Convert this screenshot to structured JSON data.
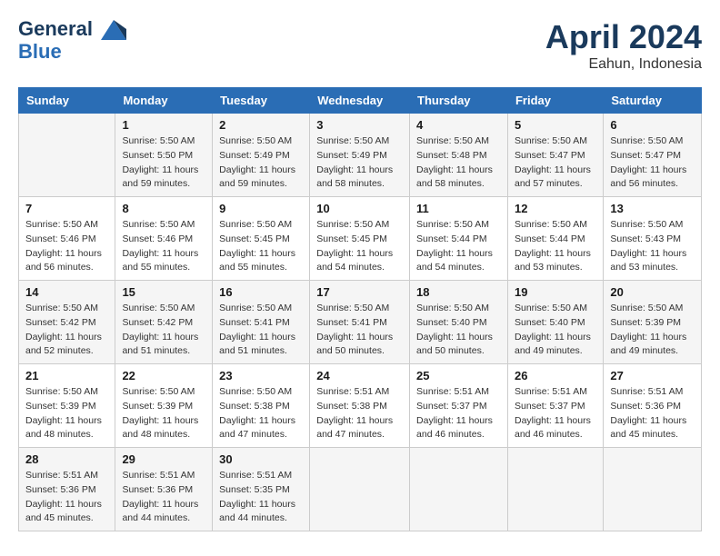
{
  "header": {
    "logo_line1": "General",
    "logo_line2": "Blue",
    "month_title": "April 2024",
    "location": "Eahun, Indonesia"
  },
  "days_of_week": [
    "Sunday",
    "Monday",
    "Tuesday",
    "Wednesday",
    "Thursday",
    "Friday",
    "Saturday"
  ],
  "weeks": [
    [
      {
        "day": "",
        "details": ""
      },
      {
        "day": "1",
        "details": "Sunrise: 5:50 AM\nSunset: 5:50 PM\nDaylight: 11 hours\nand 59 minutes."
      },
      {
        "day": "2",
        "details": "Sunrise: 5:50 AM\nSunset: 5:49 PM\nDaylight: 11 hours\nand 59 minutes."
      },
      {
        "day": "3",
        "details": "Sunrise: 5:50 AM\nSunset: 5:49 PM\nDaylight: 11 hours\nand 58 minutes."
      },
      {
        "day": "4",
        "details": "Sunrise: 5:50 AM\nSunset: 5:48 PM\nDaylight: 11 hours\nand 58 minutes."
      },
      {
        "day": "5",
        "details": "Sunrise: 5:50 AM\nSunset: 5:47 PM\nDaylight: 11 hours\nand 57 minutes."
      },
      {
        "day": "6",
        "details": "Sunrise: 5:50 AM\nSunset: 5:47 PM\nDaylight: 11 hours\nand 56 minutes."
      }
    ],
    [
      {
        "day": "7",
        "details": "Sunrise: 5:50 AM\nSunset: 5:46 PM\nDaylight: 11 hours\nand 56 minutes."
      },
      {
        "day": "8",
        "details": "Sunrise: 5:50 AM\nSunset: 5:46 PM\nDaylight: 11 hours\nand 55 minutes."
      },
      {
        "day": "9",
        "details": "Sunrise: 5:50 AM\nSunset: 5:45 PM\nDaylight: 11 hours\nand 55 minutes."
      },
      {
        "day": "10",
        "details": "Sunrise: 5:50 AM\nSunset: 5:45 PM\nDaylight: 11 hours\nand 54 minutes."
      },
      {
        "day": "11",
        "details": "Sunrise: 5:50 AM\nSunset: 5:44 PM\nDaylight: 11 hours\nand 54 minutes."
      },
      {
        "day": "12",
        "details": "Sunrise: 5:50 AM\nSunset: 5:44 PM\nDaylight: 11 hours\nand 53 minutes."
      },
      {
        "day": "13",
        "details": "Sunrise: 5:50 AM\nSunset: 5:43 PM\nDaylight: 11 hours\nand 53 minutes."
      }
    ],
    [
      {
        "day": "14",
        "details": "Sunrise: 5:50 AM\nSunset: 5:42 PM\nDaylight: 11 hours\nand 52 minutes."
      },
      {
        "day": "15",
        "details": "Sunrise: 5:50 AM\nSunset: 5:42 PM\nDaylight: 11 hours\nand 51 minutes."
      },
      {
        "day": "16",
        "details": "Sunrise: 5:50 AM\nSunset: 5:41 PM\nDaylight: 11 hours\nand 51 minutes."
      },
      {
        "day": "17",
        "details": "Sunrise: 5:50 AM\nSunset: 5:41 PM\nDaylight: 11 hours\nand 50 minutes."
      },
      {
        "day": "18",
        "details": "Sunrise: 5:50 AM\nSunset: 5:40 PM\nDaylight: 11 hours\nand 50 minutes."
      },
      {
        "day": "19",
        "details": "Sunrise: 5:50 AM\nSunset: 5:40 PM\nDaylight: 11 hours\nand 49 minutes."
      },
      {
        "day": "20",
        "details": "Sunrise: 5:50 AM\nSunset: 5:39 PM\nDaylight: 11 hours\nand 49 minutes."
      }
    ],
    [
      {
        "day": "21",
        "details": "Sunrise: 5:50 AM\nSunset: 5:39 PM\nDaylight: 11 hours\nand 48 minutes."
      },
      {
        "day": "22",
        "details": "Sunrise: 5:50 AM\nSunset: 5:39 PM\nDaylight: 11 hours\nand 48 minutes."
      },
      {
        "day": "23",
        "details": "Sunrise: 5:50 AM\nSunset: 5:38 PM\nDaylight: 11 hours\nand 47 minutes."
      },
      {
        "day": "24",
        "details": "Sunrise: 5:51 AM\nSunset: 5:38 PM\nDaylight: 11 hours\nand 47 minutes."
      },
      {
        "day": "25",
        "details": "Sunrise: 5:51 AM\nSunset: 5:37 PM\nDaylight: 11 hours\nand 46 minutes."
      },
      {
        "day": "26",
        "details": "Sunrise: 5:51 AM\nSunset: 5:37 PM\nDaylight: 11 hours\nand 46 minutes."
      },
      {
        "day": "27",
        "details": "Sunrise: 5:51 AM\nSunset: 5:36 PM\nDaylight: 11 hours\nand 45 minutes."
      }
    ],
    [
      {
        "day": "28",
        "details": "Sunrise: 5:51 AM\nSunset: 5:36 PM\nDaylight: 11 hours\nand 45 minutes."
      },
      {
        "day": "29",
        "details": "Sunrise: 5:51 AM\nSunset: 5:36 PM\nDaylight: 11 hours\nand 44 minutes."
      },
      {
        "day": "30",
        "details": "Sunrise: 5:51 AM\nSunset: 5:35 PM\nDaylight: 11 hours\nand 44 minutes."
      },
      {
        "day": "",
        "details": ""
      },
      {
        "day": "",
        "details": ""
      },
      {
        "day": "",
        "details": ""
      },
      {
        "day": "",
        "details": ""
      }
    ]
  ]
}
